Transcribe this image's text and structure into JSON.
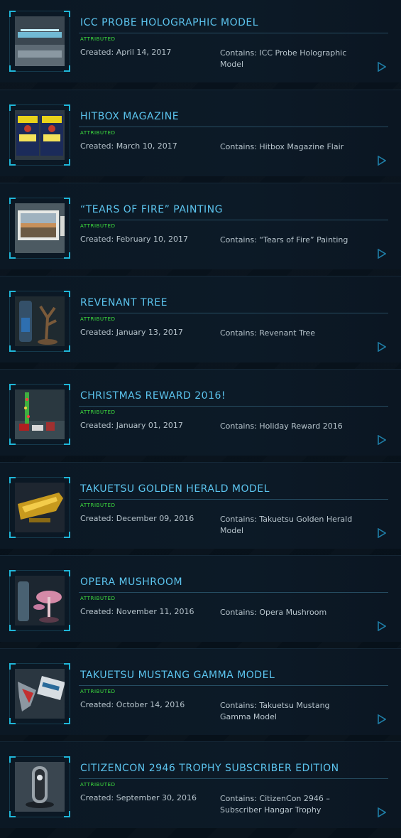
{
  "items": [
    {
      "title": "ICC PROBE HOLOGRAPHIC MODEL",
      "status": "ATTRIBUTED",
      "created": "Created: April 14, 2017",
      "contains": "Contains: ICC Probe Holographic Model",
      "image_icon": "probe-model-icon"
    },
    {
      "title": "HITBOX MAGAZINE",
      "status": "ATTRIBUTED",
      "created": "Created: March 10, 2017",
      "contains": "Contains: Hitbox Magazine Flair",
      "image_icon": "magazine-icon"
    },
    {
      "title": "“TEARS OF FIRE” PAINTING",
      "status": "ATTRIBUTED",
      "created": "Created: February 10, 2017",
      "contains": "Contains: “Tears of Fire” Painting",
      "image_icon": "painting-icon"
    },
    {
      "title": "REVENANT TREE",
      "status": "ATTRIBUTED",
      "created": "Created: January 13, 2017",
      "contains": "Contains: Revenant Tree",
      "image_icon": "tree-icon"
    },
    {
      "title": "CHRISTMAS REWARD 2016!",
      "status": "ATTRIBUTED",
      "created": "Created: January 01, 2017",
      "contains": "Contains: Holiday Reward 2016",
      "image_icon": "holiday-gift-icon"
    },
    {
      "title": "TAKUETSU GOLDEN HERALD MODEL",
      "status": "ATTRIBUTED",
      "created": "Created: December 09, 2016",
      "contains": "Contains: Takuetsu Golden Herald Model",
      "image_icon": "ship-model-icon"
    },
    {
      "title": "OPERA MUSHROOM",
      "status": "ATTRIBUTED",
      "created": "Created: November 11, 2016",
      "contains": "Contains: Opera Mushroom",
      "image_icon": "mushroom-icon"
    },
    {
      "title": "TAKUETSU MUSTANG GAMMA MODEL",
      "status": "ATTRIBUTED",
      "created": "Created: October 14, 2016",
      "contains": "Contains: Takuetsu Mustang Gamma Model",
      "image_icon": "ship-box-icon"
    },
    {
      "title": "CITIZENCON 2946 TROPHY SUBSCRIBER EDITION",
      "status": "ATTRIBUTED",
      "created": "Created: September 30, 2016",
      "contains": "Contains: CitizenCon 2946 – Subscriber Hangar Trophy",
      "image_icon": "trophy-icon"
    }
  ],
  "colors": {
    "title": "#5cc4ee",
    "status": "#3fe03f",
    "text": "#b7c4cc",
    "accent": "#1fb6d8"
  }
}
